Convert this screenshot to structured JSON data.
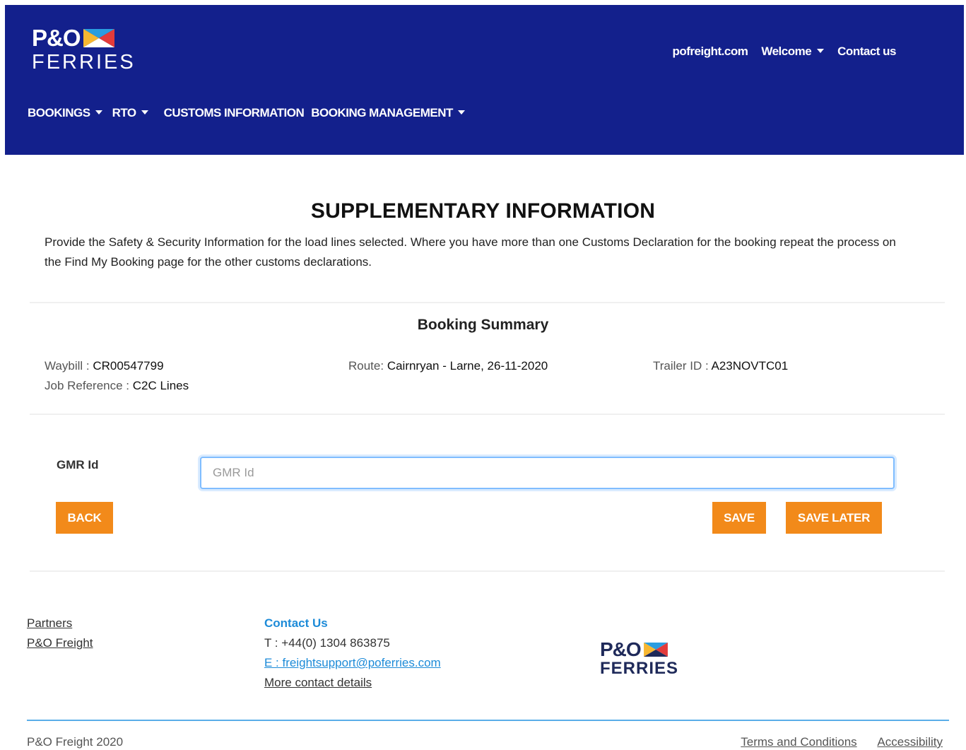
{
  "brand": {
    "primary_color": "#13208c",
    "accent_color": "#f28a1a",
    "link_color": "#1d8bd8"
  },
  "logo": {
    "line1": "P&O",
    "line2": "FERRIES"
  },
  "top_links": {
    "site": "pofreight.com",
    "welcome": "Welcome",
    "contact": "Contact us"
  },
  "nav": {
    "bookings": "BOOKINGS",
    "rto": "RTO",
    "customs": "CUSTOMS INFORMATION",
    "booking_mgmt": "BOOKING MANAGEMENT"
  },
  "page": {
    "title": "SUPPLEMENTARY INFORMATION",
    "intro": "Provide the Safety & Security Information for the load lines selected. Where you have more than one Customs Declaration for the booking repeat the process on the Find My Booking page for the other customs declarations."
  },
  "summary": {
    "title": "Booking Summary",
    "waybill_label": "Waybill : ",
    "waybill_value": "CR00547799",
    "job_label": "Job Reference : ",
    "job_value": "C2C Lines",
    "route_label": "Route: ",
    "route_value": "Cairnryan - Larne, 26-11-2020",
    "trailer_label": "Trailer ID : ",
    "trailer_value": "A23NOVTC01"
  },
  "form": {
    "gmr_label": "GMR Id",
    "gmr_placeholder": "GMR Id",
    "gmr_value": ""
  },
  "buttons": {
    "back": "BACK",
    "save": "SAVE",
    "save_later": "SAVE LATER"
  },
  "footer": {
    "partners": "Partners",
    "po_freight": "P&O Freight",
    "contact_heading": "Contact Us",
    "phone": "T : +44(0) 1304 863875",
    "email": "E : freightsupport@poferries.com",
    "more_contact": "More contact details",
    "logo_line1": "P&O",
    "logo_line2": "FERRIES",
    "copyright": "P&O Freight 2020",
    "terms": "Terms and Conditions",
    "accessibility": "Accessibility"
  }
}
